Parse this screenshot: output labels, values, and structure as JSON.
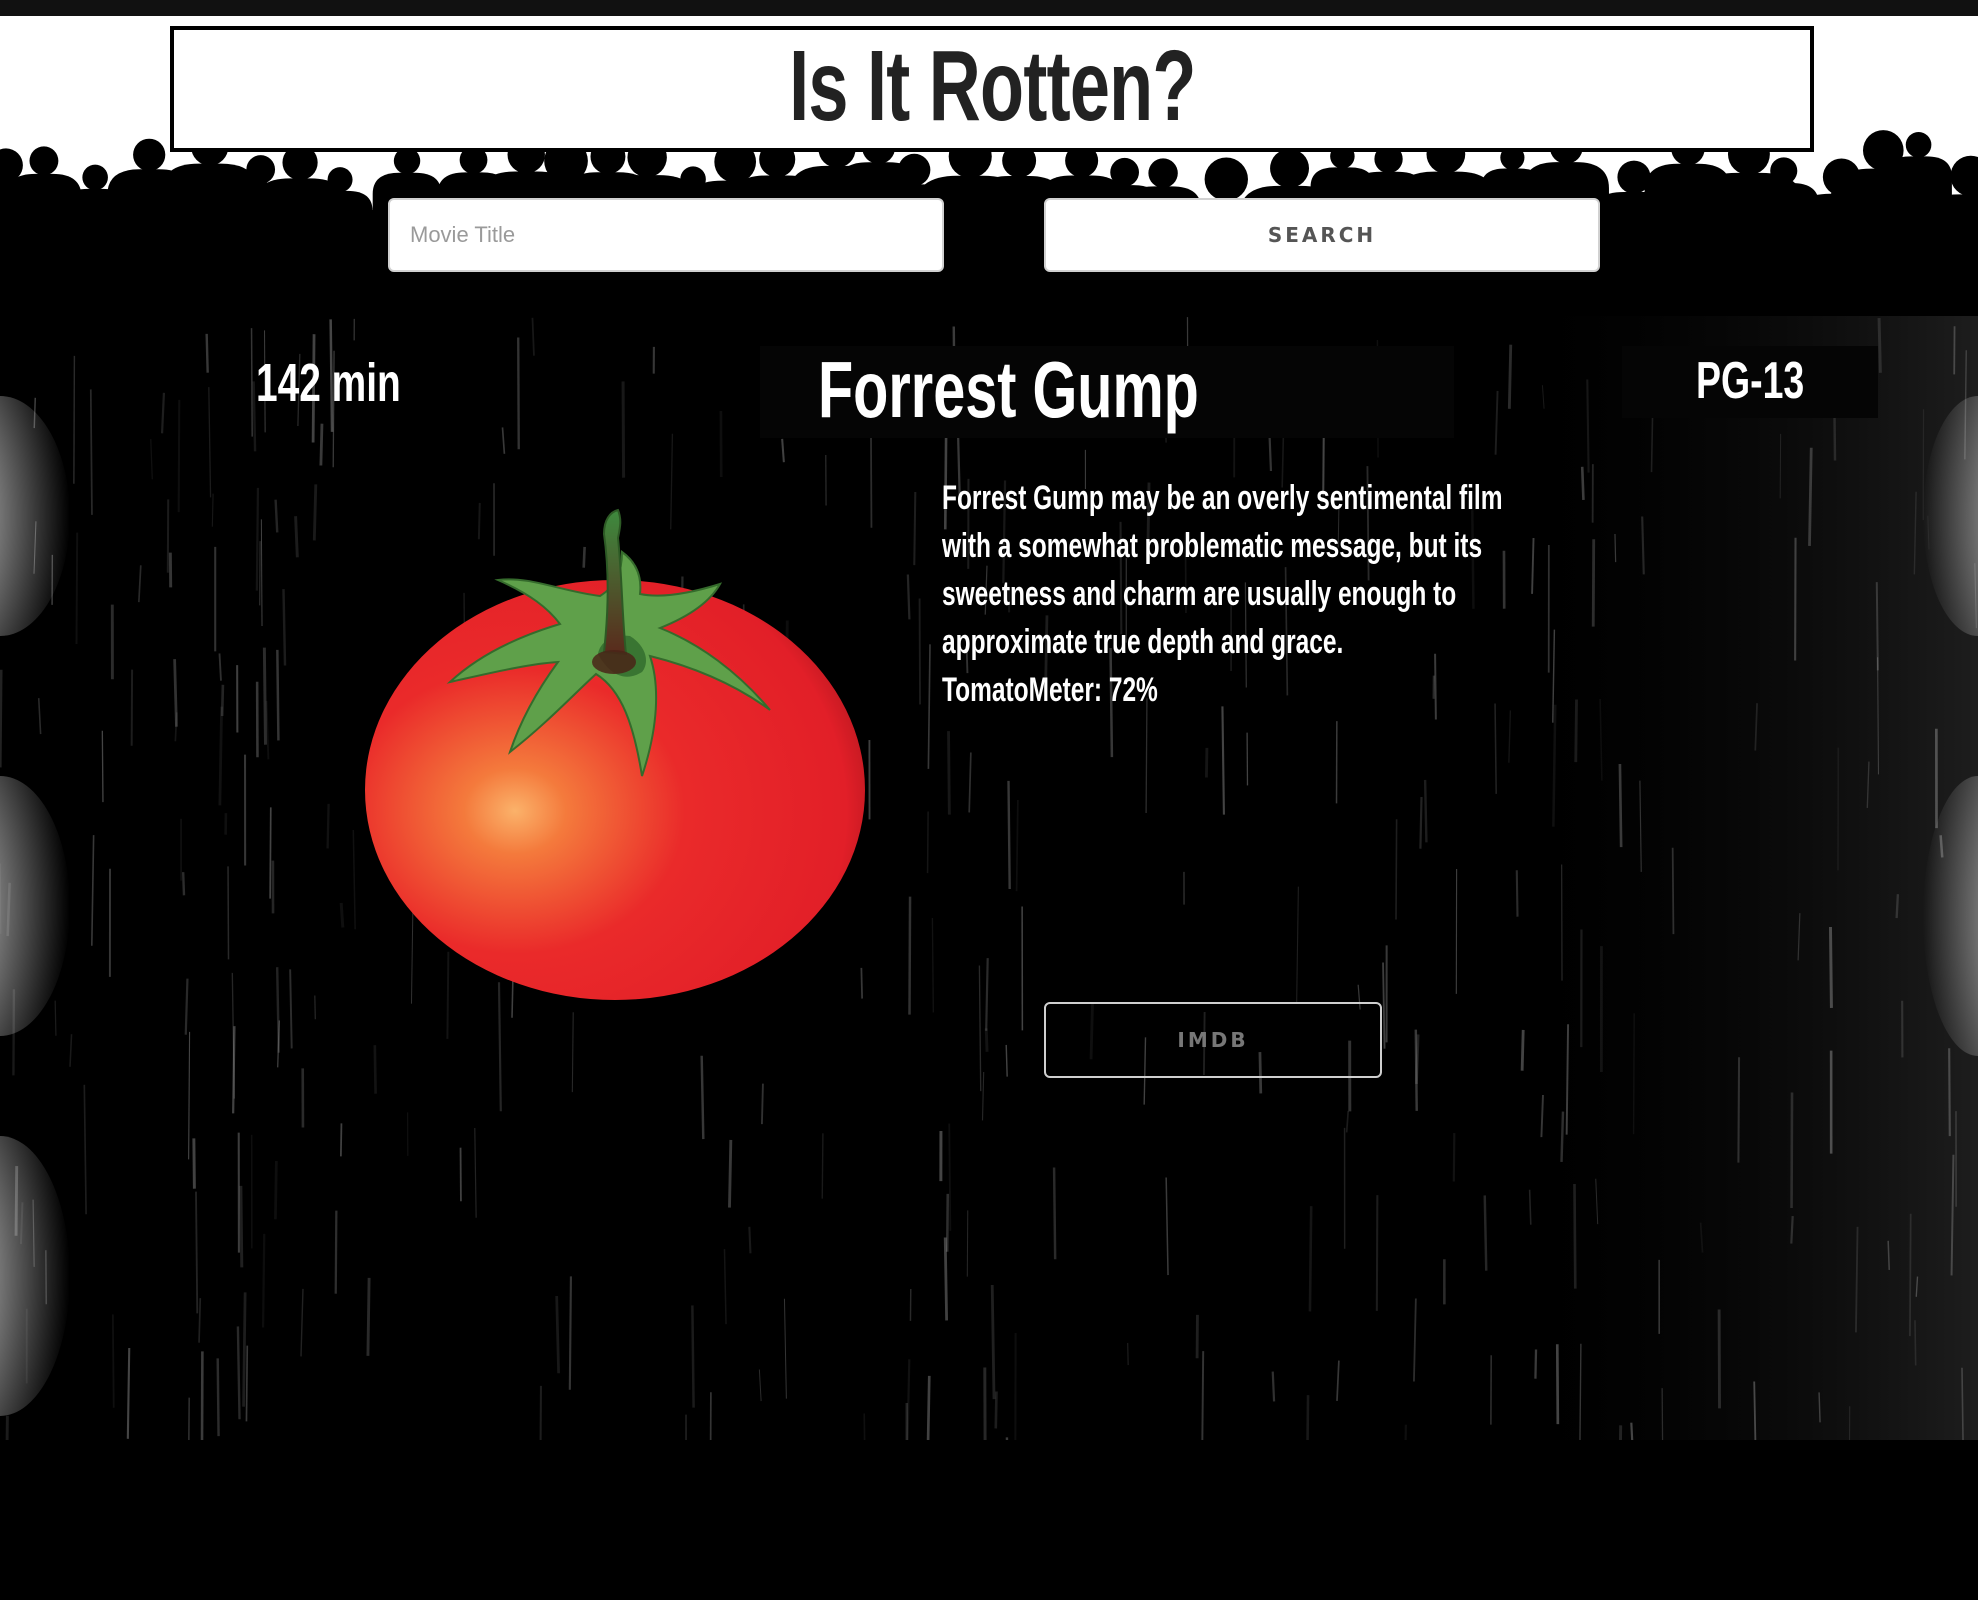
{
  "header": {
    "site_title": "Is It Rotten?",
    "search_placeholder": "Movie Title",
    "search_value": "",
    "search_button_label": "Search"
  },
  "movie": {
    "runtime": "142 min",
    "title": "Forrest Gump",
    "rating": "PG-13",
    "review_lines": [
      "Forrest Gump may be an overly sentimental film",
      "with a somewhat problematic message, but its",
      "sweetness and charm are usually enough to",
      "approximate true depth and grace.",
      "TomatoMeter: 72%"
    ],
    "tomato_icon": "fresh-tomato-icon",
    "imdb_button_label": "IMDB"
  },
  "colors": {
    "tomato_red": "#e8222a",
    "stem_green": "#5fa04a",
    "page_bg": "#000000",
    "text": "#ffffff"
  }
}
